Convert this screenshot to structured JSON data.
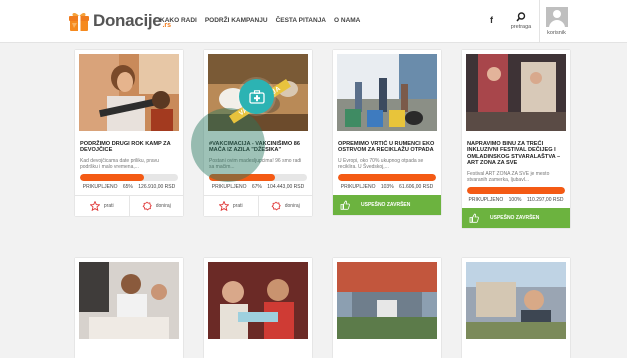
{
  "header": {
    "logo_text": "Donacije",
    "logo_tld": ".rs",
    "nav": [
      "KAKO RADI",
      "PODRŽI KAMPANJU",
      "ČESTA PITANJA",
      "O NAMA"
    ],
    "facebook": "f",
    "search_label": "pretraga",
    "user_label": "korisnik"
  },
  "cards": [
    {
      "title": "PODRŽIMO DRUGI ROK KAMP ZA DEVOJČICE",
      "desc": "Kad devojčicama date priliku, pravu podršku i malo vremena,...",
      "progress": 65,
      "stat_label": "PRIKUPLJENO",
      "stat_pct": "65%",
      "stat_amount": "126.910,00 RSD",
      "share": "prati",
      "donate": "doniraj"
    },
    {
      "title": "#VAKCIMACIJA - VAKCINIŠIMO 86 MAČA IZ AZILA \"DŽESIKA\"",
      "desc": "Postani ovim madesljupcima! 96 smo radi sa mačim...",
      "progress": 67,
      "stat_label": "PRIKUPLJENO",
      "stat_pct": "67%",
      "stat_amount": "104.443,00 RSD",
      "share": "prati",
      "donate": "doniraj",
      "ribbon": "VAKCIMACIJA"
    },
    {
      "title": "OPREMIMO VRTIĆ U RUMENCI EKO OSTRVOM ZA RECIKLAŽU OTPADA",
      "desc": "U Evropi, oko 70% ukupnog otpada se reciklira. U Švedskoj,...",
      "progress": 103,
      "stat_label": "PRIKUPLJENO",
      "stat_pct": "103%",
      "stat_amount": "61.606,00 RSD",
      "done": "USPEŠNO ZAVRŠEN"
    },
    {
      "title": "NAPRAVIMO BINU ZA TREĆI INKLUZIVNI FESTIVAL DEČIJEG I OMLADINSKOG STVARALAŠTVA – ART ZONA ZA SVE",
      "desc": "Festival ART ZONA ZA SVE je mesto stvaranih zamerka, ljubavl...",
      "progress": 100,
      "stat_label": "PRIKUPLJENO",
      "stat_pct": "100%",
      "stat_amount": "110.297,00 RSD",
      "done": "USPEŠNO ZAVRŠEN"
    }
  ],
  "colors": {
    "brand_orange": "#f07b1d",
    "progress": "#f45a14",
    "success": "#6cb33f",
    "teal": "#2cb3b3"
  }
}
